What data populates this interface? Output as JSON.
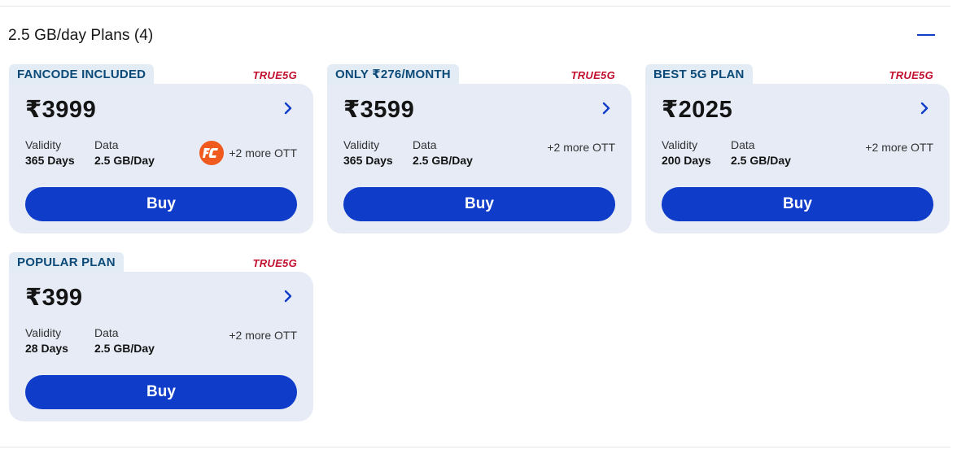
{
  "section": {
    "title": "2.5 GB/day Plans (4)"
  },
  "labels": {
    "validity": "Validity",
    "data": "Data",
    "buy": "Buy",
    "network_badge": "TRUE5G"
  },
  "plans": [
    {
      "tag": "FANCODE INCLUDED",
      "price": "₹3999",
      "validity": "365 Days",
      "data": "2.5 GB/Day",
      "ott": "+2 more OTT",
      "ott_logo": "fancode-icon"
    },
    {
      "tag": "ONLY ₹276/MONTH",
      "price": "₹3599",
      "validity": "365 Days",
      "data": "2.5 GB/Day",
      "ott": "+2 more OTT"
    },
    {
      "tag": "BEST 5G PLAN",
      "price": "₹2025",
      "validity": "200 Days",
      "data": "2.5 GB/Day",
      "ott": "+2 more OTT"
    },
    {
      "tag": "POPULAR PLAN",
      "price": "₹399",
      "validity": "28 Days",
      "data": "2.5 GB/Day",
      "ott": "+2 more OTT"
    }
  ],
  "colors": {
    "accent": "#0f3cc9",
    "card_bg": "#e6ebf6",
    "tag_bg": "#e3ecf5",
    "tag_text": "#0b4a78",
    "true5g": "#c20e2f",
    "fancode": "#f15a1e"
  }
}
